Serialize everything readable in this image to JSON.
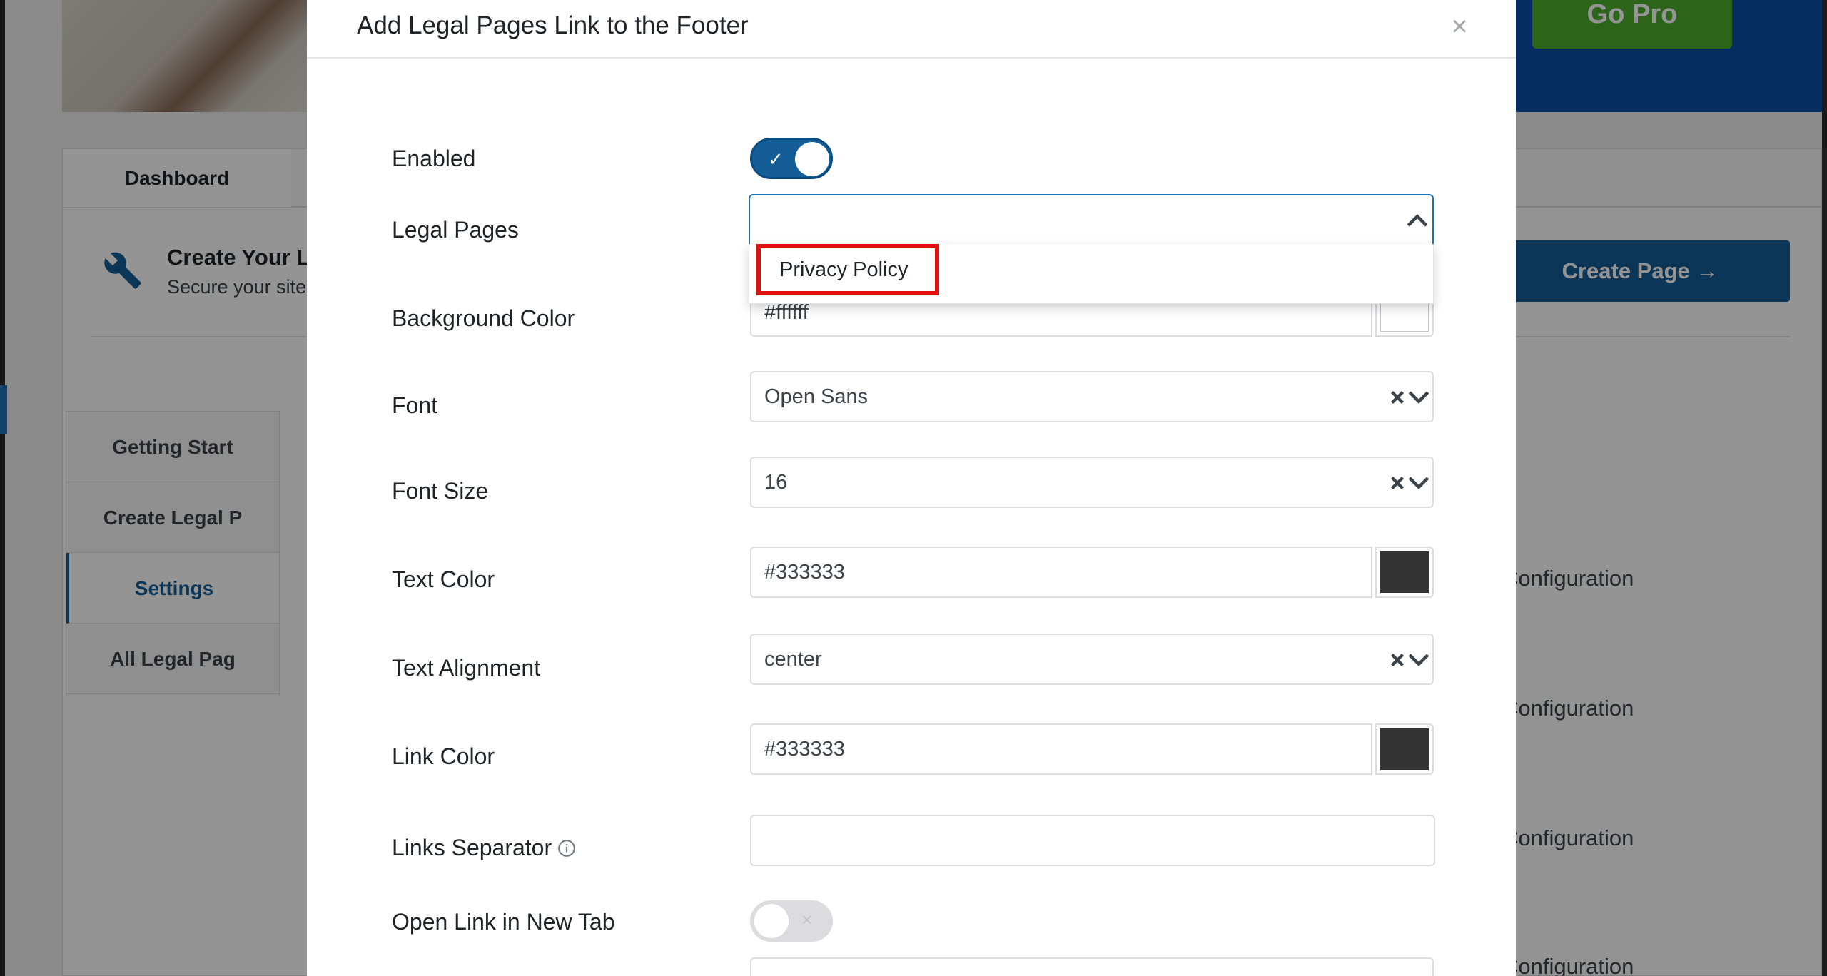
{
  "background": {
    "go_pro_label": "Go Pro",
    "tab_dashboard": "Dashboard",
    "create_title": "Create Your L",
    "create_sub": "Secure your site",
    "create_button": "Create Page →",
    "sidebar": [
      {
        "label": "Getting Start"
      },
      {
        "label": "Create Legal P"
      },
      {
        "label": "Settings"
      },
      {
        "label": "All Legal Pag"
      }
    ],
    "config_label": "Configuration"
  },
  "modal": {
    "title": "Add Legal Pages Link to the Footer",
    "close_label": "×",
    "enabled_label": "Enabled",
    "legal_pages_label": "Legal Pages",
    "legal_pages_option": "Privacy Policy",
    "background_color_label": "Background Color",
    "background_color_value": "#ffffff",
    "font_label": "Font",
    "font_value": "Open Sans",
    "font_size_label": "Font Size",
    "font_size_value": "16",
    "text_color_label": "Text Color",
    "text_color_value": "#333333",
    "text_alignment_label": "Text Alignment",
    "text_alignment_value": "center",
    "link_color_label": "Link Color",
    "link_color_value": "#333333",
    "links_separator_label": "Links Separator",
    "open_new_tab_label": "Open Link in New Tab",
    "toggle_on_mark": "✓",
    "toggle_off_mark": "×"
  },
  "colors": {
    "accent": "#135e96",
    "highlight": "#e01010",
    "text_swatch": "#333333",
    "bg_swatch": "#ffffff"
  }
}
